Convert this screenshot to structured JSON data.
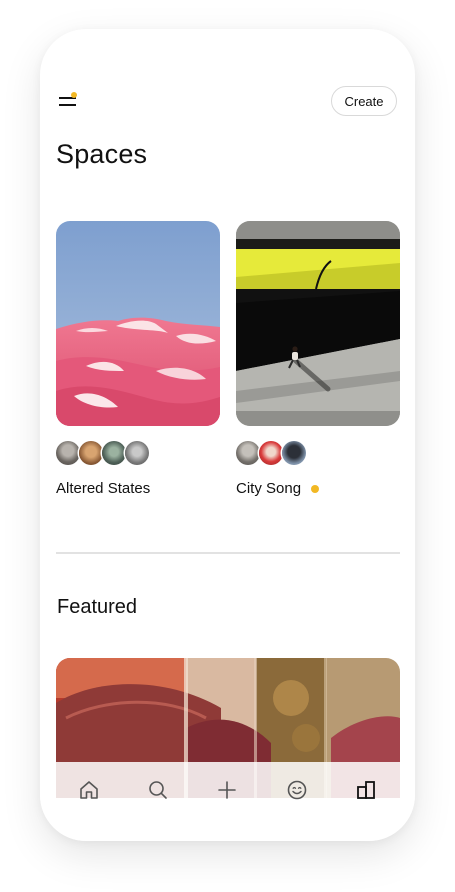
{
  "header": {
    "menu_icon": "menu-icon",
    "notification_dot_color": "#F2B824",
    "create_label": "Create"
  },
  "page_title": "Spaces",
  "spaces": [
    {
      "name": "Altered States",
      "image": "pink-desert-dunes",
      "members": 4,
      "unread": false
    },
    {
      "name": "City Song",
      "image": "runner-under-yellow-overpass",
      "members": 3,
      "unread": true
    }
  ],
  "featured": {
    "title": "Featured",
    "image": "umbrellas-collage"
  },
  "tabbar": {
    "items": [
      "home-icon",
      "search-icon",
      "plus-icon",
      "smiley-icon",
      "spaces-icon"
    ],
    "active": "spaces-icon"
  },
  "accent_color": "#F2B824"
}
